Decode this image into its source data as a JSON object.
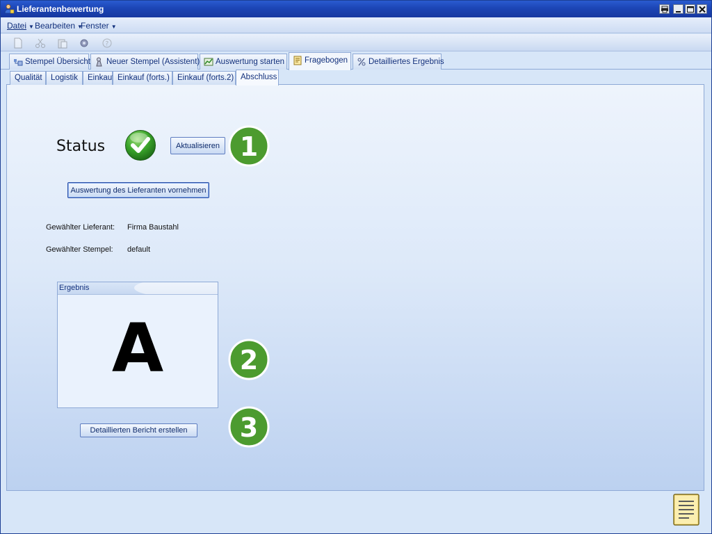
{
  "window": {
    "title": "Lieferantenbewertung"
  },
  "menu": [
    {
      "label": "Datei",
      "accel": "D"
    },
    {
      "label": "Bearbeiten",
      "accel": "B"
    },
    {
      "label": "Fenster",
      "accel": "F"
    }
  ],
  "main_tabs": [
    {
      "label": "Stempel Übersicht",
      "icon": "stamp-overview-icon"
    },
    {
      "label": "Neuer Stempel (Assistent)",
      "icon": "wizard-icon"
    },
    {
      "label": "Auswertung starten",
      "icon": "chart-icon"
    },
    {
      "label": "Fragebogen",
      "icon": "questionnaire-icon",
      "active": true
    },
    {
      "label": "Detailliertes Ergebnis",
      "icon": "percent-icon"
    }
  ],
  "sub_tabs": [
    {
      "label": "Qualität"
    },
    {
      "label": "Logistik"
    },
    {
      "label": "Einkauf"
    },
    {
      "label": "Einkauf (forts.)"
    },
    {
      "label": "Einkauf (forts.2)"
    },
    {
      "label": "Abschluss",
      "active": true
    }
  ],
  "content": {
    "status_label": "Status",
    "status_state": "ok",
    "refresh_button": "Aktualisieren",
    "evaluate_button": "Auswertung des Lieferanten vornehmen",
    "supplier_label": "Gewählter Lieferant:",
    "supplier_value": "Firma Baustahl",
    "stamp_label": "Gewählter Stempel:",
    "stamp_value": "default",
    "result_title": "Ergebnis",
    "result_grade": "A",
    "report_button": "Detaillierten Bericht erstellen"
  },
  "badges": [
    "1",
    "2",
    "3"
  ],
  "colors": {
    "badge_green": "#4c9b2f",
    "title_bar": "#1c45b5",
    "check_green": "#3aa52a"
  }
}
